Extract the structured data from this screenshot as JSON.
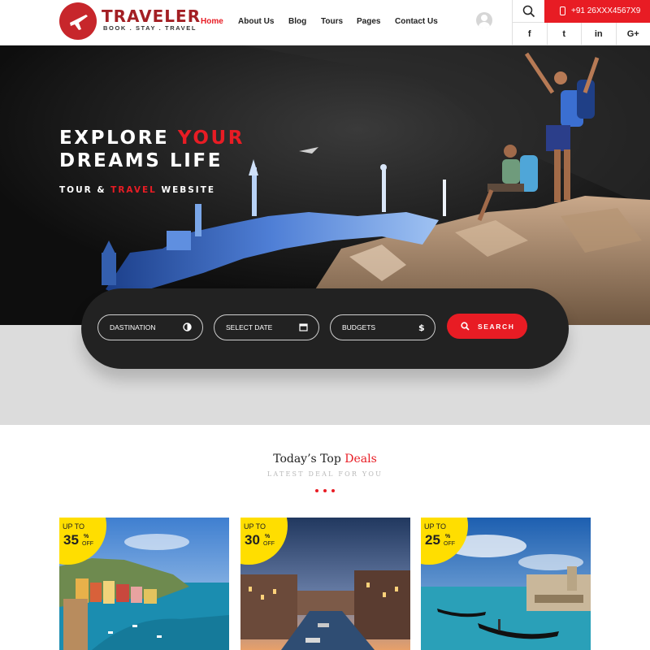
{
  "brand": {
    "name": "TRAVELER",
    "tagline": "BOOK . STAY . TRAVEL",
    "accent_color": "#e81c24",
    "logo_color": "#c7262b"
  },
  "nav": {
    "items": [
      {
        "label": "Home",
        "active": true
      },
      {
        "label": "About Us"
      },
      {
        "label": "Blog"
      },
      {
        "label": "Tours"
      },
      {
        "label": "Pages"
      },
      {
        "label": "Contact Us"
      }
    ]
  },
  "header": {
    "phone": "+91 26XXX4567X9",
    "social": [
      "f",
      "t",
      "in",
      "G+"
    ],
    "icons": {
      "search": "search-icon",
      "avatar": "user-avatar-icon",
      "phone": "mobile-phone-icon"
    }
  },
  "hero": {
    "title_line1_a": "EXPLORE ",
    "title_line1_b": "YOUR",
    "title_line2": "DREAMS LIFE",
    "sub_a": "TOUR & ",
    "sub_b": "TRAVEL",
    "sub_c": " WEBSITE"
  },
  "search": {
    "destination": "DASTINATION",
    "date": "SELECT DATE",
    "budget": "BUDGETS",
    "button": "SEARCH"
  },
  "deals": {
    "title_a": "Today’s Top ",
    "title_b": "Deals",
    "subtitle": "LATEST DEAL FOR YOU",
    "cards": [
      {
        "up_to": "UP TO",
        "discount": "35",
        "percent": "%",
        "off": "OFF"
      },
      {
        "up_to": "UP TO",
        "discount": "30",
        "percent": "%",
        "off": "OFF"
      },
      {
        "up_to": "UP TO",
        "discount": "25",
        "percent": "%",
        "off": "OFF"
      }
    ]
  }
}
